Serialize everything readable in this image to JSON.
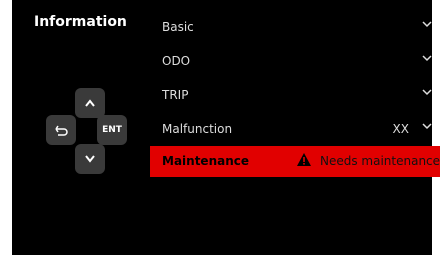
{
  "panel": {
    "title": "Information"
  },
  "dpad": {
    "enter_label": "ENT"
  },
  "menu": {
    "items": [
      {
        "label": "Basic"
      },
      {
        "label": "ODO"
      },
      {
        "label": "TRIP"
      },
      {
        "label": "Malfunction",
        "value": "XX"
      },
      {
        "label": "Maintenance",
        "status": "Needs maintenance"
      }
    ]
  },
  "colors": {
    "background": "#000000",
    "highlight": "#e10000",
    "button": "#3a3a3a"
  },
  "icons": {
    "chevron": "chevron-down-icon",
    "warning": "warning-triangle-icon",
    "back": "back-arrow-icon"
  }
}
